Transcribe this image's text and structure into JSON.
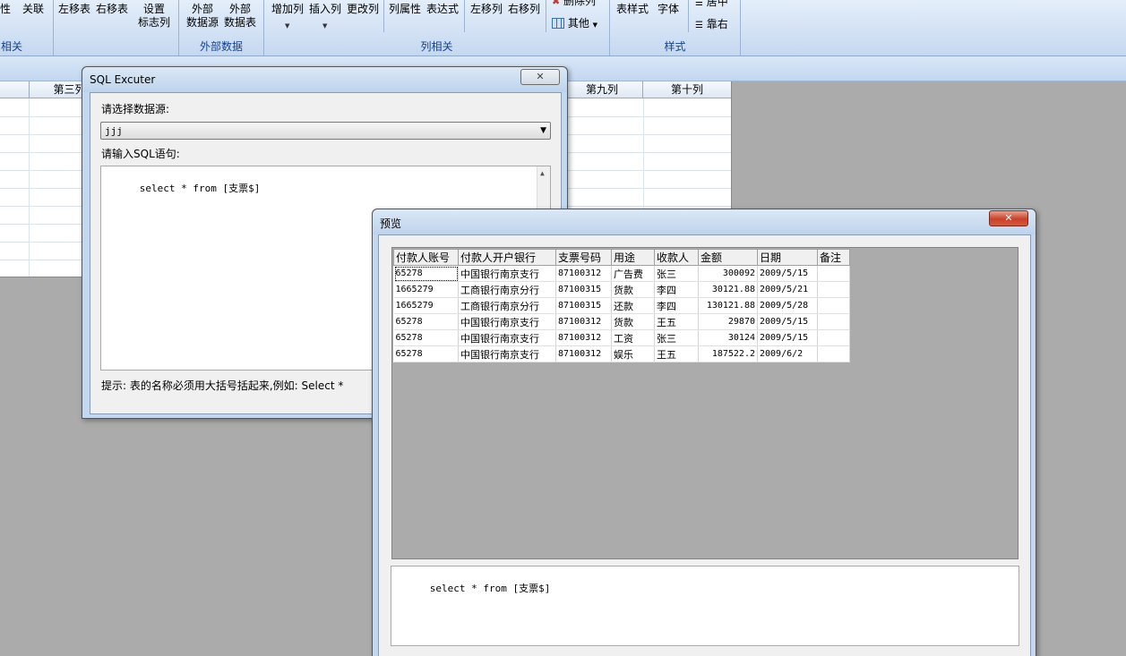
{
  "ribbon": {
    "buttons": [
      {
        "label": "性"
      },
      {
        "label": "关联"
      },
      {
        "label": "左移表"
      },
      {
        "label": "右移表"
      },
      {
        "label": "设置",
        "label2": "标志列"
      },
      {
        "label": "外部",
        "label2": "数据源"
      },
      {
        "label": "外部",
        "label2": "数据表"
      },
      {
        "label": "增加列"
      },
      {
        "label": "插入列"
      },
      {
        "label": "更改列"
      },
      {
        "label": "列属性"
      },
      {
        "label": "表达式"
      },
      {
        "label": "左移列"
      },
      {
        "label": "右移列"
      },
      {
        "label": "删除列"
      },
      {
        "label": "其他"
      },
      {
        "label": "表样式"
      },
      {
        "label": "字体"
      },
      {
        "label": "居中"
      },
      {
        "label": "靠右"
      }
    ],
    "groups": [
      "相关",
      "外部数据",
      "列相关",
      "样式"
    ]
  },
  "sheet": {
    "headers": [
      "第三列",
      "第九列",
      "第十列"
    ]
  },
  "sql_dialog": {
    "title": "SQL Excuter",
    "datasource_label": "请选择数据源:",
    "datasource_value": "jjj",
    "sql_label": "请输入SQL语句:",
    "sql_text": "select * from [支票$]",
    "hint": "提示: 表的名称必须用大括号括起来,例如: Select *"
  },
  "preview_dialog": {
    "title": "预览",
    "columns": [
      "付款人账号",
      "付款人开户银行",
      "支票号码",
      "用途",
      "收款人",
      "金额",
      "日期",
      "备注"
    ],
    "rows": [
      [
        "65278",
        "中国银行南京支行",
        "87100312",
        "广告费",
        "张三",
        "300092",
        "2009/5/15",
        ""
      ],
      [
        "1665279",
        "工商银行南京分行",
        "87100315",
        "货款",
        "李四",
        "30121.88",
        "2009/5/21",
        ""
      ],
      [
        "1665279",
        "工商银行南京分行",
        "87100315",
        "还款",
        "李四",
        "130121.88",
        "2009/5/28",
        ""
      ],
      [
        "65278",
        "中国银行南京支行",
        "87100312",
        "货款",
        "王五",
        "29870",
        "2009/5/15",
        ""
      ],
      [
        "65278",
        "中国银行南京支行",
        "87100312",
        "工资",
        "张三",
        "30124",
        "2009/5/15",
        ""
      ],
      [
        "65278",
        "中国银行南京支行",
        "87100312",
        "娱乐",
        "王五",
        "187522.2",
        "2009/6/2",
        ""
      ]
    ],
    "sql_text": "select * from [支票$]"
  }
}
